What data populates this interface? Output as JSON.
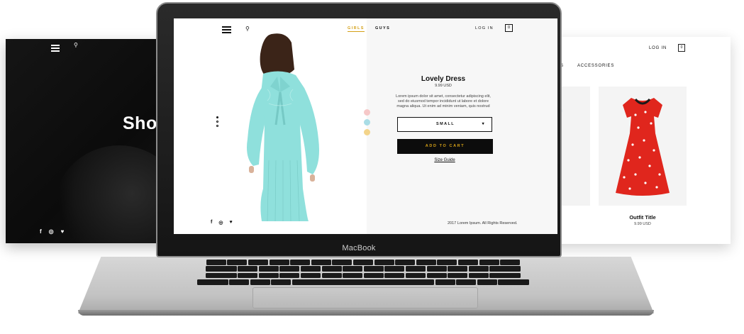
{
  "left_screen": {
    "title": "Shop",
    "search_icon": "search-icon",
    "socials": [
      "f",
      "◎",
      "♥"
    ]
  },
  "right_screen": {
    "login": "LOG IN",
    "cart_count": "0",
    "category_prefix": "S",
    "category_accessories": "ACCESSORIES",
    "outfit_title": "Outfit Title",
    "outfit_price": "9.99 USD"
  },
  "laptop": {
    "brand": "MacBook"
  },
  "main_screen": {
    "nav": {
      "girls": "GIRLS",
      "guys": "GUYS",
      "login": "LOG IN",
      "cart_count": "0"
    },
    "product": {
      "title": "Lovely Dress",
      "price": "9.99 USD",
      "description": "Lorem ipsum dolor sit amet, consectetur adipiscing elit, sed do eiusmod tempor incididunt ut labore et dolore magna aliqua. Ut enim ad minim veniam, quis nostrud",
      "size_selected": "SMALL",
      "add_to_cart": "ADD TO CART",
      "size_guide": "Size Guide"
    },
    "swatches": [
      "#f6c8c8",
      "#a9dde6",
      "#f3d48a"
    ],
    "socials": [
      "f",
      "◎",
      "♥"
    ],
    "copyright": "2017 Lorem Ipsum. All Rights Reserved."
  },
  "colors": {
    "accent_gold": "#d4a017",
    "dress_mint": "#8fe0dc",
    "dress_red": "#e0261d"
  }
}
